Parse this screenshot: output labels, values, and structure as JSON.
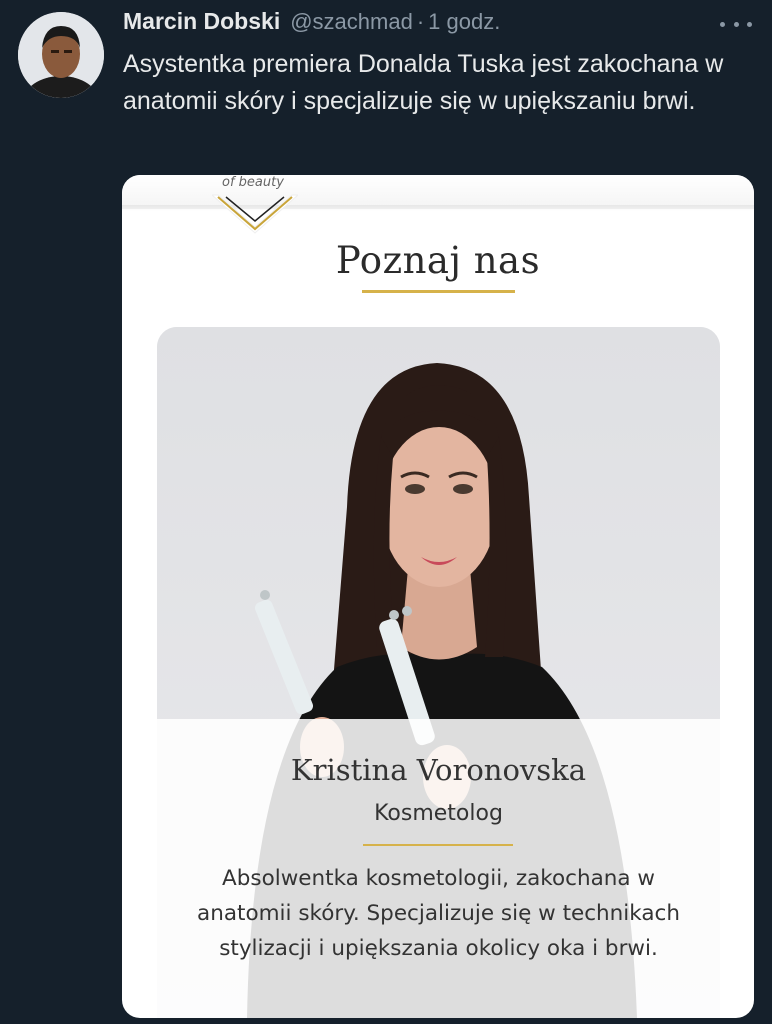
{
  "tweet": {
    "author_name": "Marcin Dobski",
    "author_handle": "@szachmad",
    "separator": "·",
    "timestamp": "1 godz.",
    "text": "Asystentka premiera Donalda Tuska jest zakochana w anatomii skóry i specjalizuje się w upiększaniu brwi.",
    "more_icon": "ellipsis-icon",
    "avatar": "user-avatar"
  },
  "card": {
    "brand_tagline": "of beauty",
    "section_title": "Poznaj nas",
    "person_name": "Kristina Voronovska",
    "person_role": "Kosmetolog",
    "person_bio": "Absolwentka kosmetologii, zakochana w anatomii skóry. Specjalizuje się w technikach stylizacji i upiększania okolicy oka i brwi.",
    "accent_color": "#d6b24a"
  },
  "colors": {
    "background": "#15202b",
    "primary_text": "#e7e9ea",
    "secondary_text": "#8b98a5"
  }
}
